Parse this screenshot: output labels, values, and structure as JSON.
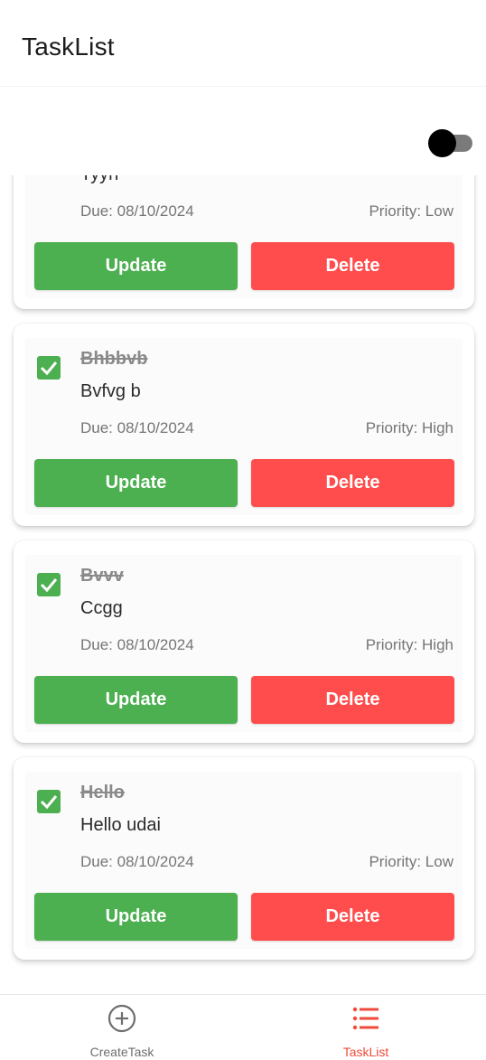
{
  "header": {
    "title": "TaskList"
  },
  "toggle": {
    "state": "off"
  },
  "colors": {
    "update": "#4caf50",
    "delete": "#ff4d4d",
    "checkbox": "#4caf50",
    "active_tab": "#f04a3a",
    "inactive_tab": "#6e6e6e"
  },
  "tasks": [
    {
      "title": "",
      "description": "Tyyh",
      "due": "Due: 08/10/2024",
      "priority": "Priority: Low",
      "completed": true,
      "update_label": "Update",
      "delete_label": "Delete"
    },
    {
      "title": "Bhbbvb",
      "description": " Bvfvg b",
      "due": "Due: 08/10/2024",
      "priority": "Priority: High",
      "completed": true,
      "update_label": "Update",
      "delete_label": "Delete"
    },
    {
      "title": "Bvvv",
      "description": "Ccgg",
      "due": "Due: 08/10/2024",
      "priority": "Priority: High",
      "completed": true,
      "update_label": "Update",
      "delete_label": "Delete"
    },
    {
      "title": "Hello",
      "description": "Hello udai",
      "due": "Due: 08/10/2024",
      "priority": "Priority: Low",
      "completed": true,
      "update_label": "Update",
      "delete_label": "Delete"
    }
  ],
  "bottom_nav": {
    "items": [
      {
        "label": "CreateTask",
        "icon": "plus-circle-icon",
        "active": false
      },
      {
        "label": "TaskList",
        "icon": "list-icon",
        "active": true
      }
    ]
  }
}
